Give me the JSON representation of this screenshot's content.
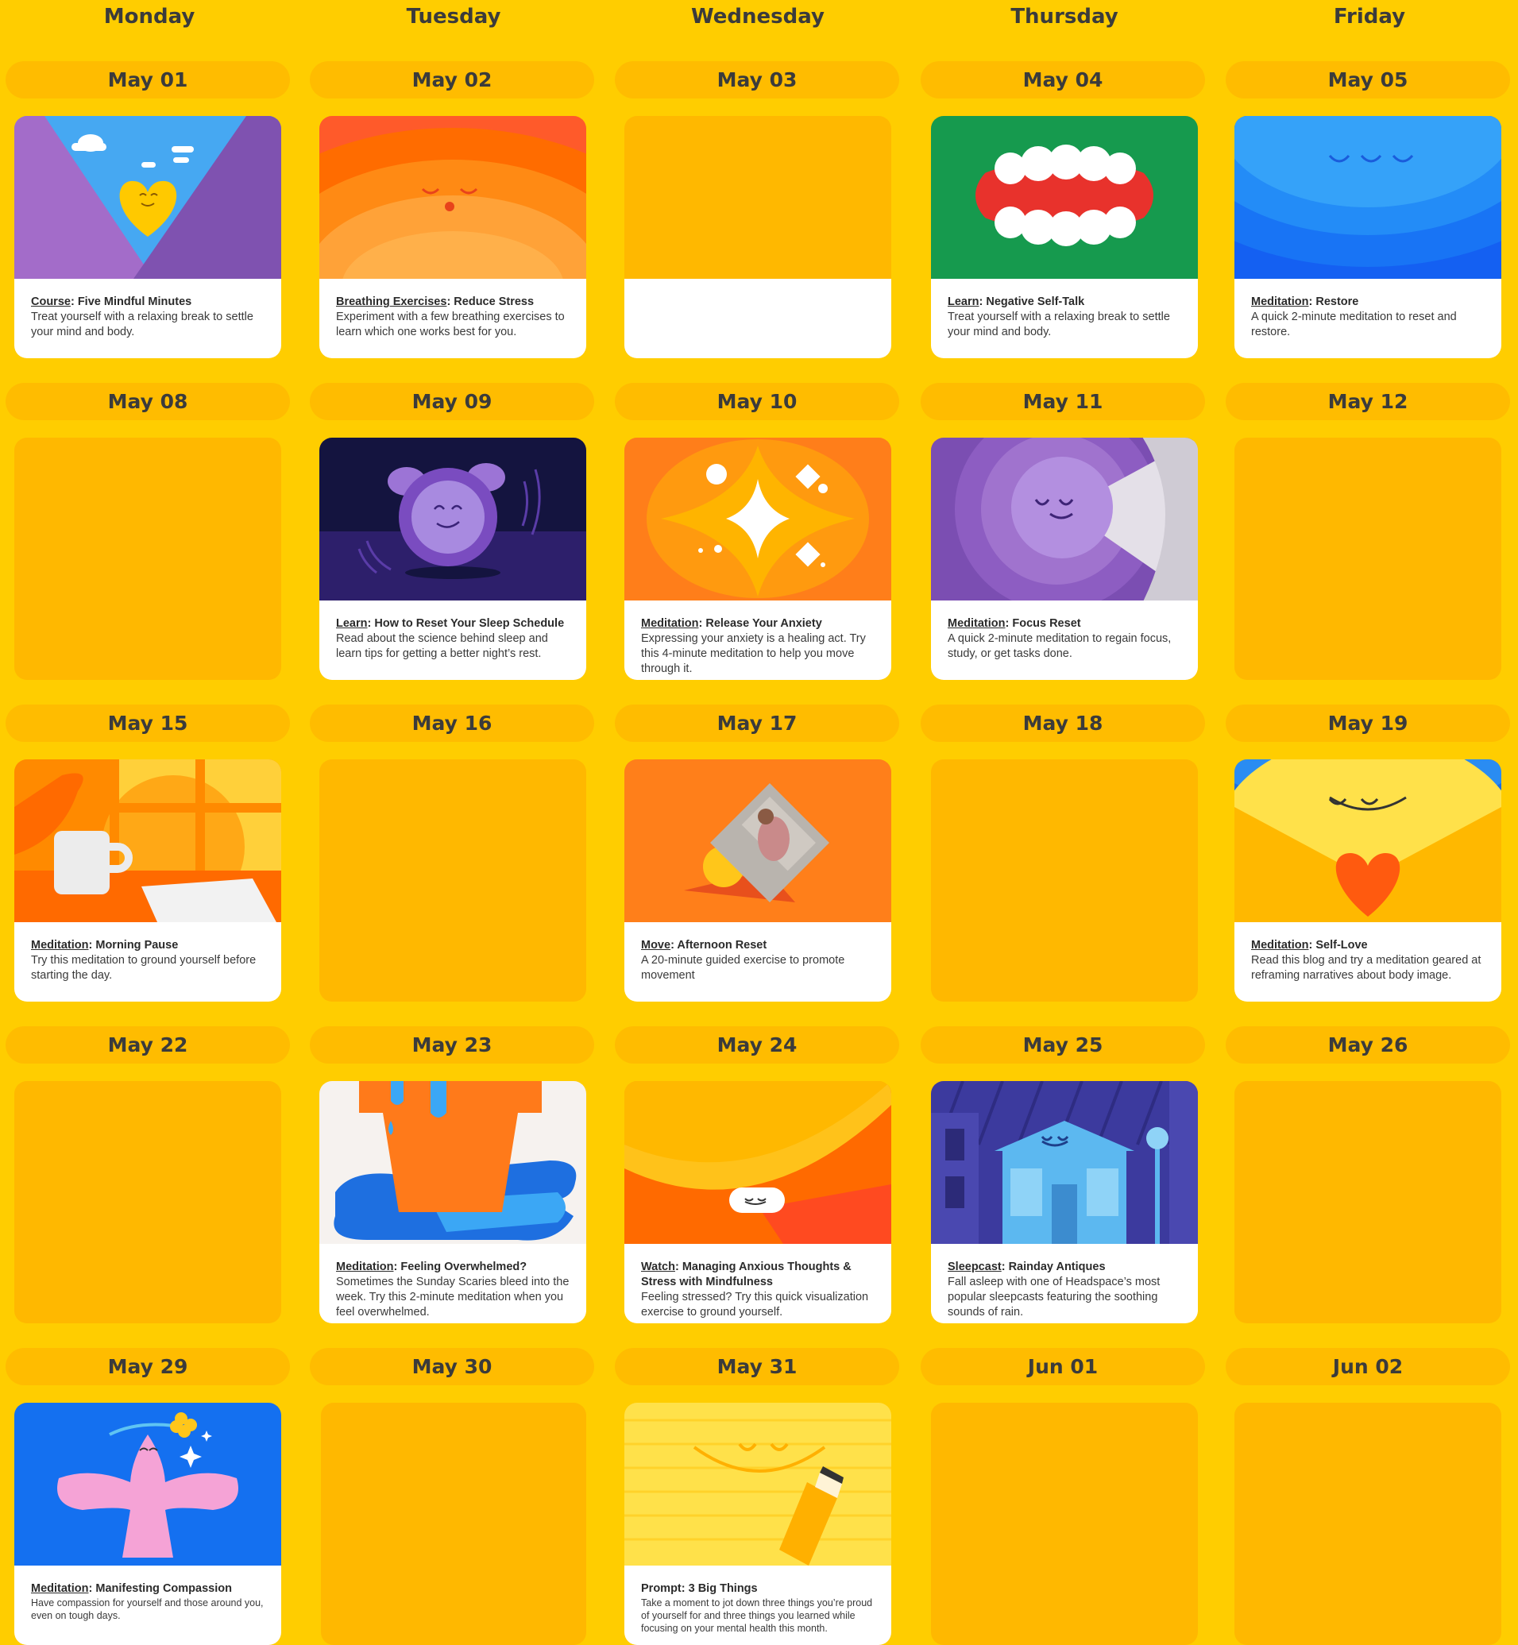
{
  "weekdays": [
    "Monday",
    "Tuesday",
    "Wednesday",
    "Thursday",
    "Friday"
  ],
  "dates": [
    [
      "May 01",
      "May 02",
      "May 03",
      "May 04",
      "May 05"
    ],
    [
      "May 08",
      "May 09",
      "May 10",
      "May 11",
      "May 12"
    ],
    [
      "May 15",
      "May 16",
      "May 17",
      "May 18",
      "May 19"
    ],
    [
      "May 22",
      "May 23",
      "May 24",
      "May 25",
      "May 26"
    ],
    [
      "May 29",
      "May 30",
      "May 31",
      "Jun 01",
      "Jun 02"
    ]
  ],
  "cards": {
    "may01": {
      "category": "Course",
      "sep": ": ",
      "title": "Five Mindful Minutes",
      "desc": "Treat yourself with a relaxing break to settle your mind and body."
    },
    "may02": {
      "category": "Breathing Exercises",
      "sep": ": ",
      "title": "Reduce Stress",
      "desc": "Experiment with a few breathing exercises to learn which one works best for you."
    },
    "may04": {
      "category": "Learn",
      "sep": ": ",
      "title": "Negative Self-Talk",
      "desc": "Treat yourself with a relaxing break to settle your mind and body."
    },
    "may05": {
      "category": "Meditation",
      "sep": ": ",
      "title": "Restore",
      "desc": "A quick 2-minute meditation to reset and restore."
    },
    "may09": {
      "category": "Learn",
      "sep": ": ",
      "title": "How to Reset Your Sleep Schedule",
      "desc": "Read about the science behind sleep and learn tips for getting a better night’s rest."
    },
    "may10": {
      "category": "Meditation",
      "sep": ": ",
      "title": "Release Your Anxiety",
      "desc": "Expressing your anxiety is a healing act. Try this 4-minute meditation to help you move through it."
    },
    "may11": {
      "category": "Meditation",
      "sep": ": ",
      "title": "Focus Reset",
      "desc": "A quick 2-minute meditation to regain focus, study, or get tasks done."
    },
    "may15": {
      "category": "Meditation",
      "sep": ": ",
      "title": "Morning Pause",
      "desc": "Try this meditation to ground yourself before starting the day."
    },
    "may17": {
      "category": "Move",
      "sep": ": ",
      "title": "Afternoon Reset",
      "desc": "A 20-minute guided exercise to promote movement"
    },
    "may19": {
      "category": "Meditation",
      "sep": ": ",
      "title": "Self-Love",
      "desc": "Read this blog and try a meditation geared at  reframing narratives about body image."
    },
    "may23": {
      "category": "Meditation",
      "sep": ": ",
      "title": "Feeling Overwhelmed?",
      "desc": "Sometimes the Sunday Scaries bleed into the week. Try this 2-minute meditation when you feel overwhelmed."
    },
    "may24": {
      "category": "Watch",
      "sep": ": ",
      "title": "Managing Anxious Thoughts & Stress with Mindfulness",
      "desc": "Feeling stressed? Try this quick visualization exercise to ground yourself."
    },
    "may25": {
      "category": "Sleepcast",
      "sep": ": ",
      "title": "Rainday Antiques",
      "desc": "Fall asleep with one of Headspace’s most popular sleepcasts featuring the soothing sounds of rain."
    },
    "may29": {
      "category": "Meditation",
      "sep": ": ",
      "title": "Manifesting Compassion",
      "desc": "Have compassion for yourself and those around you, even on tough days."
    },
    "may31": {
      "category": "",
      "sep": "",
      "title": "Prompt: 3 Big Things",
      "desc": "Take a moment to jot down three things you’re proud of yourself for and three things you learned while focusing on your mental health this month."
    }
  },
  "colors": {
    "background": "#FFCD00",
    "pill": "#FFBC00",
    "empty_card": "#FFB800",
    "text": "#3B3B3B"
  }
}
